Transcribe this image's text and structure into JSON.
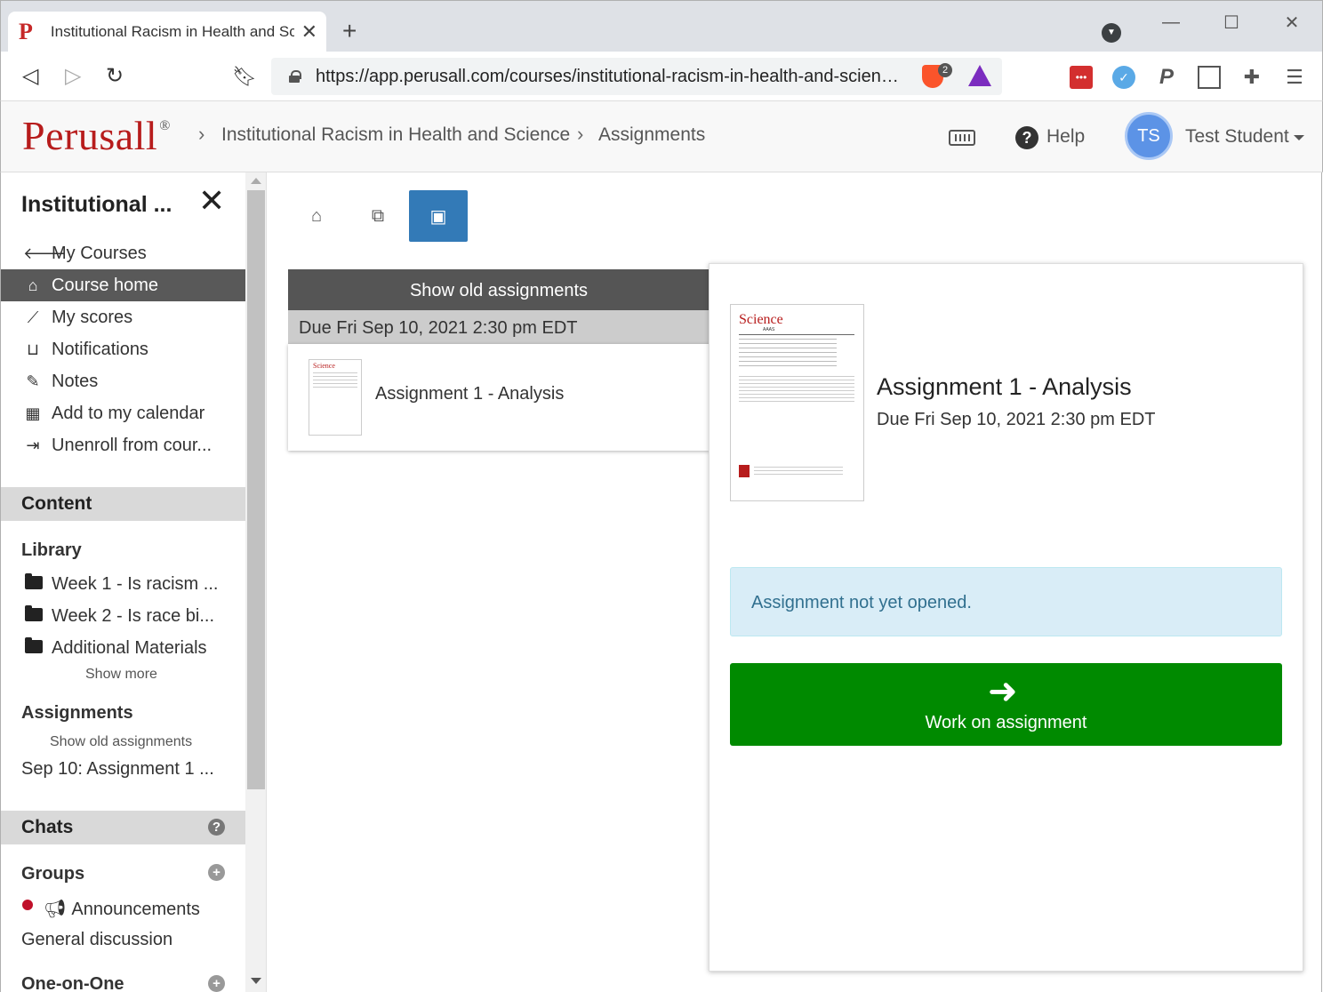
{
  "browser": {
    "tab_title": "Institutional Racism in Health and Science",
    "tab_favicon": "P",
    "url": "https://app.perusall.com/courses/institutional-racism-in-health-and-science/assignments",
    "brave_badge": "2"
  },
  "header": {
    "logo": "Perusall",
    "logo_mark": "®",
    "breadcrumb_course": "Institutional Racism in Health and Science",
    "breadcrumb_page": "Assignments",
    "help_label": "Help",
    "avatar_initials": "TS",
    "user_name": "Test Student"
  },
  "sidebar": {
    "title": "Institutional ...",
    "items": [
      {
        "label": "My Courses",
        "icon": "arrow-left-icon"
      },
      {
        "label": "Course home",
        "icon": "home-icon"
      },
      {
        "label": "My scores",
        "icon": "chart-line-icon"
      },
      {
        "label": "Notifications",
        "icon": "inbox-icon"
      },
      {
        "label": "Notes",
        "icon": "pencil-icon"
      },
      {
        "label": "Add to my calendar",
        "icon": "calendar-icon"
      },
      {
        "label": "Unenroll from cour...",
        "icon": "sign-out-icon"
      }
    ],
    "content_header": "Content",
    "library_header": "Library",
    "library_items": [
      "Week 1 - Is racism ...",
      "Week 2 - Is race bi...",
      "Additional Materials"
    ],
    "show_more": "Show more",
    "assignments_header": "Assignments",
    "show_old_assignments": "Show old assignments",
    "assignment_link": "Sep 10: Assignment 1 ...",
    "chats_header": "Chats",
    "groups_header": "Groups",
    "groups": [
      "Announcements",
      "General discussion"
    ],
    "one_on_one_header": "One-on-One"
  },
  "main": {
    "show_old_assignments": "Show old assignments",
    "due_label": "Due Fri Sep 10, 2021 2:30 pm EDT",
    "card_title": "Assignment 1 - Analysis",
    "detail": {
      "title": "Assignment 1 - Analysis",
      "due": "Due Fri Sep 10, 2021 2:30 pm EDT",
      "alert": "Assignment not yet opened.",
      "work_button": "Work on assignment",
      "thumb_journal": "Science",
      "thumb_publisher": "AAAS"
    }
  },
  "colors": {
    "brand_red": "#b71c1c",
    "active_blue": "#337ab7",
    "work_green": "#008a00",
    "alert_bg": "#d9edf7"
  }
}
